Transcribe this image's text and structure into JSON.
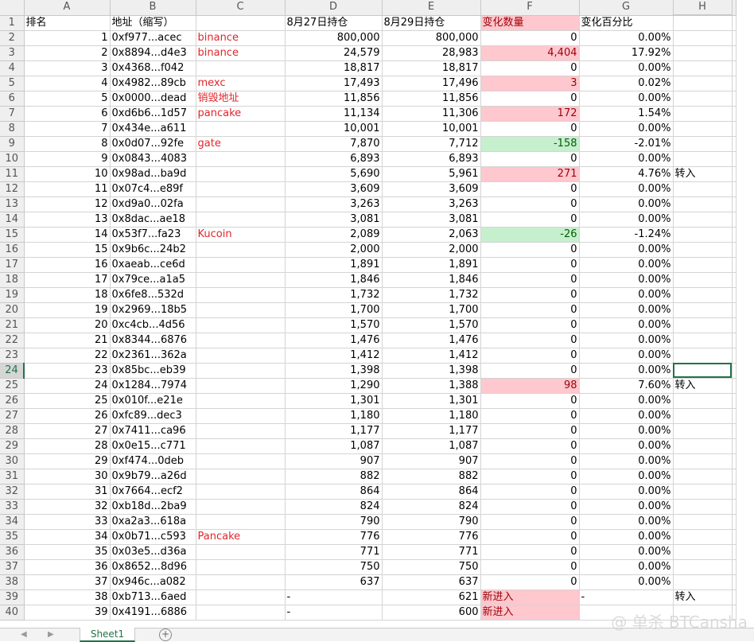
{
  "columns": [
    "A",
    "B",
    "C",
    "D",
    "E",
    "F",
    "G",
    "H"
  ],
  "selected_column": "H",
  "selected_row": 24,
  "header_row": {
    "A": "排名",
    "B": "地址（缩写）",
    "C": "",
    "D": "8月27日持仓",
    "E": "8月29日持仓",
    "F": "变化数量",
    "G": "变化百分比",
    "H": ""
  },
  "rows": [
    {
      "num": 2,
      "A": "1",
      "B": "0xf977...acec",
      "C": "binance",
      "D": "800,000",
      "E": "800,000",
      "F": "0",
      "G": "0.00%",
      "H": "",
      "fc": ""
    },
    {
      "num": 3,
      "A": "2",
      "B": "0x8894...d4e3",
      "C": "binance",
      "D": "24,579",
      "E": "28,983",
      "F": "4,404",
      "G": "17.92%",
      "H": "",
      "fc": "pink"
    },
    {
      "num": 4,
      "A": "3",
      "B": "0x4368...f042",
      "C": "",
      "D": "18,817",
      "E": "18,817",
      "F": "0",
      "G": "0.00%",
      "H": "",
      "fc": ""
    },
    {
      "num": 5,
      "A": "4",
      "B": "0x4982...89cb",
      "C": "mexc",
      "D": "17,493",
      "E": "17,496",
      "F": "3",
      "G": "0.02%",
      "H": "",
      "fc": "pink"
    },
    {
      "num": 6,
      "A": "5",
      "B": "0x0000...dead",
      "C": "销毁地址",
      "D": "11,856",
      "E": "11,856",
      "F": "0",
      "G": "0.00%",
      "H": "",
      "fc": ""
    },
    {
      "num": 7,
      "A": "6",
      "B": "0xd6b6...1d57",
      "C": "pancake",
      "D": "11,134",
      "E": "11,306",
      "F": "172",
      "G": "1.54%",
      "H": "",
      "fc": "pink"
    },
    {
      "num": 8,
      "A": "7",
      "B": "0x434e...a611",
      "C": "",
      "D": "10,001",
      "E": "10,001",
      "F": "0",
      "G": "0.00%",
      "H": "",
      "fc": ""
    },
    {
      "num": 9,
      "A": "8",
      "B": "0x0d07...92fe",
      "C": "gate",
      "D": "7,870",
      "E": "7,712",
      "F": "-158",
      "G": "-2.01%",
      "H": "",
      "fc": "green"
    },
    {
      "num": 10,
      "A": "9",
      "B": "0x0843...4083",
      "C": "",
      "D": "6,893",
      "E": "6,893",
      "F": "0",
      "G": "0.00%",
      "H": "",
      "fc": ""
    },
    {
      "num": 11,
      "A": "10",
      "B": "0x98ad...ba9d",
      "C": "",
      "D": "5,690",
      "E": "5,961",
      "F": "271",
      "G": "4.76%",
      "H": "转入",
      "fc": "pink"
    },
    {
      "num": 12,
      "A": "11",
      "B": "0x07c4...e89f",
      "C": "",
      "D": "3,609",
      "E": "3,609",
      "F": "0",
      "G": "0.00%",
      "H": "",
      "fc": ""
    },
    {
      "num": 13,
      "A": "12",
      "B": "0xd9a0...02fa",
      "C": "",
      "D": "3,263",
      "E": "3,263",
      "F": "0",
      "G": "0.00%",
      "H": "",
      "fc": ""
    },
    {
      "num": 14,
      "A": "13",
      "B": "0x8dac...ae18",
      "C": "",
      "D": "3,081",
      "E": "3,081",
      "F": "0",
      "G": "0.00%",
      "H": "",
      "fc": ""
    },
    {
      "num": 15,
      "A": "14",
      "B": "0x53f7...fa23",
      "C": "Kucoin",
      "D": "2,089",
      "E": "2,063",
      "F": "-26",
      "G": "-1.24%",
      "H": "",
      "fc": "green"
    },
    {
      "num": 16,
      "A": "15",
      "B": "0x9b6c...24b2",
      "C": "",
      "D": "2,000",
      "E": "2,000",
      "F": "0",
      "G": "0.00%",
      "H": "",
      "fc": ""
    },
    {
      "num": 17,
      "A": "16",
      "B": "0xaeab...ce6d",
      "C": "",
      "D": "1,891",
      "E": "1,891",
      "F": "0",
      "G": "0.00%",
      "H": "",
      "fc": ""
    },
    {
      "num": 18,
      "A": "17",
      "B": "0x79ce...a1a5",
      "C": "",
      "D": "1,846",
      "E": "1,846",
      "F": "0",
      "G": "0.00%",
      "H": "",
      "fc": ""
    },
    {
      "num": 19,
      "A": "18",
      "B": "0x6fe8...532d",
      "C": "",
      "D": "1,732",
      "E": "1,732",
      "F": "0",
      "G": "0.00%",
      "H": "",
      "fc": ""
    },
    {
      "num": 20,
      "A": "19",
      "B": "0x2969...18b5",
      "C": "",
      "D": "1,700",
      "E": "1,700",
      "F": "0",
      "G": "0.00%",
      "H": "",
      "fc": ""
    },
    {
      "num": 21,
      "A": "20",
      "B": "0xc4cb...4d56",
      "C": "",
      "D": "1,570",
      "E": "1,570",
      "F": "0",
      "G": "0.00%",
      "H": "",
      "fc": ""
    },
    {
      "num": 22,
      "A": "21",
      "B": "0x8344...6876",
      "C": "",
      "D": "1,476",
      "E": "1,476",
      "F": "0",
      "G": "0.00%",
      "H": "",
      "fc": ""
    },
    {
      "num": 23,
      "A": "22",
      "B": "0x2361...362a",
      "C": "",
      "D": "1,412",
      "E": "1,412",
      "F": "0",
      "G": "0.00%",
      "H": "",
      "fc": ""
    },
    {
      "num": 24,
      "A": "23",
      "B": "0x85bc...eb39",
      "C": "",
      "D": "1,398",
      "E": "1,398",
      "F": "0",
      "G": "0.00%",
      "H": "",
      "fc": ""
    },
    {
      "num": 25,
      "A": "24",
      "B": "0x1284...7974",
      "C": "",
      "D": "1,290",
      "E": "1,388",
      "F": "98",
      "G": "7.60%",
      "H": "转入",
      "fc": "pink"
    },
    {
      "num": 26,
      "A": "25",
      "B": "0x010f...e21e",
      "C": "",
      "D": "1,301",
      "E": "1,301",
      "F": "0",
      "G": "0.00%",
      "H": "",
      "fc": ""
    },
    {
      "num": 27,
      "A": "26",
      "B": "0xfc89...dec3",
      "C": "",
      "D": "1,180",
      "E": "1,180",
      "F": "0",
      "G": "0.00%",
      "H": "",
      "fc": ""
    },
    {
      "num": 28,
      "A": "27",
      "B": "0x7411...ca96",
      "C": "",
      "D": "1,177",
      "E": "1,177",
      "F": "0",
      "G": "0.00%",
      "H": "",
      "fc": ""
    },
    {
      "num": 29,
      "A": "28",
      "B": "0x0e15...c771",
      "C": "",
      "D": "1,087",
      "E": "1,087",
      "F": "0",
      "G": "0.00%",
      "H": "",
      "fc": ""
    },
    {
      "num": 30,
      "A": "29",
      "B": "0xf474...0deb",
      "C": "",
      "D": "907",
      "E": "907",
      "F": "0",
      "G": "0.00%",
      "H": "",
      "fc": ""
    },
    {
      "num": 31,
      "A": "30",
      "B": "0x9b79...a26d",
      "C": "",
      "D": "882",
      "E": "882",
      "F": "0",
      "G": "0.00%",
      "H": "",
      "fc": ""
    },
    {
      "num": 32,
      "A": "31",
      "B": "0x7664...ecf2",
      "C": "",
      "D": "864",
      "E": "864",
      "F": "0",
      "G": "0.00%",
      "H": "",
      "fc": ""
    },
    {
      "num": 33,
      "A": "32",
      "B": "0xb18d...2ba9",
      "C": "",
      "D": "824",
      "E": "824",
      "F": "0",
      "G": "0.00%",
      "H": "",
      "fc": ""
    },
    {
      "num": 34,
      "A": "33",
      "B": "0xa2a3...618a",
      "C": "",
      "D": "790",
      "E": "790",
      "F": "0",
      "G": "0.00%",
      "H": "",
      "fc": ""
    },
    {
      "num": 35,
      "A": "34",
      "B": "0x0b71...c593",
      "C": "Pancake",
      "D": "776",
      "E": "776",
      "F": "0",
      "G": "0.00%",
      "H": "",
      "fc": ""
    },
    {
      "num": 36,
      "A": "35",
      "B": "0x03e5...d36a",
      "C": "",
      "D": "771",
      "E": "771",
      "F": "0",
      "G": "0.00%",
      "H": "",
      "fc": ""
    },
    {
      "num": 37,
      "A": "36",
      "B": "0x8652...8d96",
      "C": "",
      "D": "750",
      "E": "750",
      "F": "0",
      "G": "0.00%",
      "H": "",
      "fc": ""
    },
    {
      "num": 38,
      "A": "37",
      "B": "0x946c...a082",
      "C": "",
      "D": "637",
      "E": "637",
      "F": "0",
      "G": "0.00%",
      "H": "",
      "fc": ""
    },
    {
      "num": 39,
      "A": "38",
      "B": "0xb713...6aed",
      "C": "",
      "D": "-",
      "E": "621",
      "F": "新进入",
      "G": "-",
      "H": "转入",
      "fc": "pinkleft"
    },
    {
      "num": 40,
      "A": "39",
      "B": "0x4191...6886",
      "C": "",
      "D": "-",
      "E": "600",
      "F": "新进入",
      "G": "",
      "H": "",
      "fc": "pinkleft"
    }
  ],
  "sheet_tab": "Sheet1",
  "watermark": "@ 单杀 BTCansha",
  "colors": {
    "label_red": "#e0262b",
    "increase_fill": "#ffc7ce",
    "decrease_fill": "#c6efce",
    "selection": "#217346"
  }
}
